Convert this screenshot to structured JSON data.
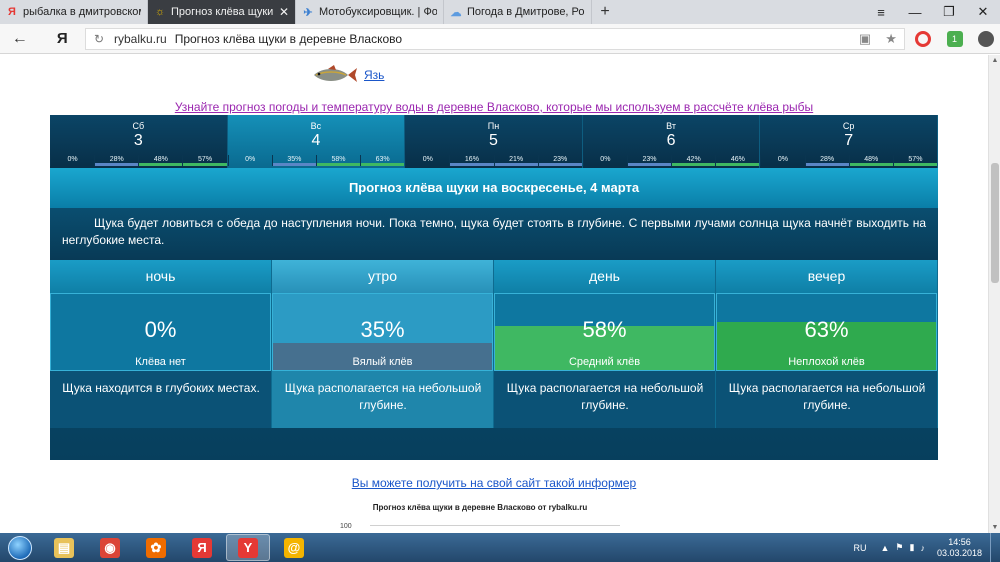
{
  "browser": {
    "tabs": [
      {
        "favicon": "Я",
        "title": "рыбалка в дмитровском ра",
        "active": false,
        "fav_color": "#e53935"
      },
      {
        "favicon": "☼",
        "title": "Прогноз клёва щуки в де",
        "active": true,
        "fav_color": "#e0b400"
      },
      {
        "favicon": "✈",
        "title": "Мотобуксировщик. | Форум",
        "active": false,
        "fav_color": "#3b7fd1"
      },
      {
        "favicon": "☁",
        "title": "Погода в Дмитрове, Росси",
        "active": false,
        "fav_color": "#5c9be0"
      }
    ],
    "new_tab": "+",
    "window_controls": {
      "menu": "≡",
      "minimize": "—",
      "restore": "❐",
      "close": "✕"
    },
    "address": {
      "back": "←",
      "logo": "Я",
      "reload": "↻",
      "host": "rybalku.ru",
      "page_title": "Прогноз клёва щуки в деревне Власково",
      "bookmark": "★",
      "reader": "▣"
    }
  },
  "page": {
    "fish": {
      "name": "Язь",
      "icon": "fish-icon"
    },
    "weather_link": "Узнайте прогноз погоды и температуру воды в деревне Власково, которые мы используем в рассчёте клёва рыбы",
    "days": [
      {
        "name": "Сб",
        "num": "3",
        "pcts": [
          "0%",
          "28%",
          "48%",
          "57%"
        ],
        "selected": false
      },
      {
        "name": "Вс",
        "num": "4",
        "pcts": [
          "0%",
          "35%",
          "58%",
          "63%"
        ],
        "selected": true
      },
      {
        "name": "Пн",
        "num": "5",
        "pcts": [
          "0%",
          "16%",
          "21%",
          "23%"
        ],
        "selected": false
      },
      {
        "name": "Вт",
        "num": "6",
        "pcts": [
          "0%",
          "23%",
          "42%",
          "46%"
        ],
        "selected": false
      },
      {
        "name": "Ср",
        "num": "7",
        "pcts": [
          "0%",
          "28%",
          "48%",
          "57%"
        ],
        "selected": false
      }
    ],
    "forecast_title": "Прогноз клёва щуки на воскресенье, 4 марта",
    "description": "Щука будет ловиться с обеда до наступления ночи. Пока темно, щука будет стоять в глубине. С первыми лучами солнца щука начнёт выходить на неглубокие места.",
    "periods": [
      {
        "name": "ночь",
        "value": "0%",
        "level": 0,
        "label": "Клёва нет",
        "text": "Щука находится в глубоких местах.",
        "fill_color": "#0e77a0"
      },
      {
        "name": "утро",
        "value": "35%",
        "level": 0.35,
        "label": "Вялый клёв",
        "text": "Щука располагается на небольшой глубине.",
        "fill_color": "#46708f"
      },
      {
        "name": "день",
        "value": "58%",
        "level": 0.58,
        "label": "Средний клёв",
        "text": "Щука располагается на небольшой глубине.",
        "fill_color": "#3fb862"
      },
      {
        "name": "вечер",
        "value": "63%",
        "level": 0.63,
        "label": "Неплохой клёв",
        "text": "Щука располагается на небольшой глубине.",
        "fill_color": "#2faa4e"
      }
    ],
    "informer_link": "Вы можете получить на свой сайт такой информер",
    "chart_title": "Прогноз клёва щуки в деревне Власково от rybalku.ru",
    "chart_axis_top": "100"
  },
  "taskbar": {
    "apps": [
      {
        "icon": "folder-icon",
        "glyph": "▤",
        "color": "#e8c25a",
        "active": false
      },
      {
        "icon": "chrome-icon",
        "glyph": "◉",
        "color": "#db4437",
        "active": false
      },
      {
        "icon": "media-player-icon",
        "glyph": "✿",
        "color": "#ef6c00",
        "active": false
      },
      {
        "icon": "yandex-icon",
        "glyph": "Я",
        "color": "#e53935",
        "active": false
      },
      {
        "icon": "yandex-browser-icon",
        "glyph": "Y",
        "color": "#e53935",
        "active": true
      },
      {
        "icon": "chat-icon",
        "glyph": "@",
        "color": "#f4b400",
        "active": false
      }
    ],
    "lang": "RU",
    "time": "14:56",
    "date": "03.03.2018"
  },
  "colors": {
    "bar_low": "#5a86c6",
    "bar_mid": "#3fb862",
    "bar_zero": "#0a3550"
  }
}
